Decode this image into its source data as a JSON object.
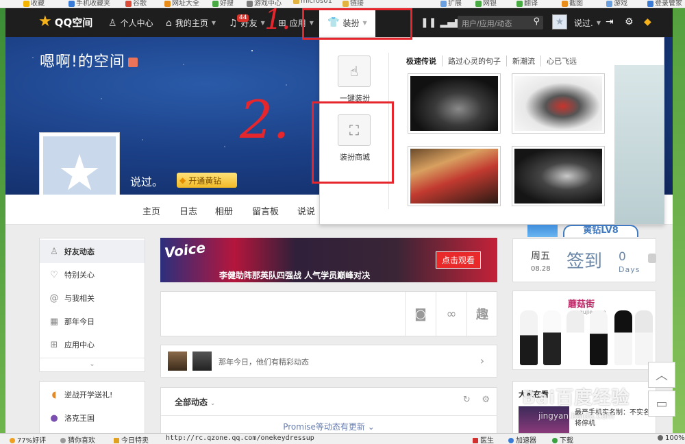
{
  "favorites": [
    "收藏",
    "手机收藏夹",
    "谷歌",
    "网址大全",
    "好搜",
    "游戏中心",
    "micros01",
    "链接",
    "扩展",
    "网银",
    "翻译",
    "截图",
    "游戏",
    "登录管家"
  ],
  "topnav": {
    "logo": "QQ空间",
    "items": {
      "personal": "个人中心",
      "home": "我的主页",
      "friends": "好友",
      "friends_badge": "44",
      "apps": "应用",
      "dressup": "装扮"
    },
    "search_placeholder": "用户/应用/动态",
    "username": "说过."
  },
  "annotations": {
    "one": "1.",
    "two": "2."
  },
  "profile": {
    "title": "嗯啊!的空间",
    "nickname": "说过。",
    "vip_button": "开通黄钻",
    "tabs": [
      "主页",
      "日志",
      "相册",
      "留言板",
      "说说"
    ]
  },
  "dress_menu": {
    "one_click": "一键装扮",
    "mall": "装扮商城",
    "themes": [
      "极速传说",
      "路过心灵的句子",
      "新潮流",
      "心已飞远"
    ]
  },
  "sidebar": {
    "main": [
      {
        "icon": "person",
        "label": "好友动态"
      },
      {
        "icon": "heart",
        "label": "特别关心"
      },
      {
        "icon": "at",
        "label": "与我相关"
      },
      {
        "icon": "calendar",
        "label": "那年今日"
      },
      {
        "icon": "grid",
        "label": "应用中心"
      }
    ],
    "extra": [
      {
        "label": "逆战开学送礼!"
      },
      {
        "label": "洛克王国"
      }
    ]
  },
  "ad": {
    "brand": "Voice",
    "caption": "李健助阵那英队四强战 人气学员巅峰对决",
    "watch": "点击观看"
  },
  "memory": {
    "text": "那年今日，他们有精彩动态"
  },
  "feed": {
    "title": "全部动态",
    "update": "Promise等动态有更新"
  },
  "signin": {
    "weekday": "周五",
    "date": "08.28",
    "label": "签到",
    "days_count": "0",
    "days_label": "Days"
  },
  "level_badge": "黄钻LV8",
  "shop_ad": {
    "name": "蘑菇街",
    "domain": "mogujie.com"
  },
  "news": {
    "title": "大家在看",
    "text": "最严手机实名制：不实名将停机"
  },
  "watermark": {
    "main": "Bai百度经验",
    "sub": "jingyan.baidu.com"
  },
  "statusbar": {
    "left": [
      "77%好评",
      "猜你喜欢",
      "今日特卖"
    ],
    "url": "http://rc.qzone.qq.com/onekeydressup",
    "right": [
      "医生",
      "加速器",
      "下载",
      "100%"
    ]
  },
  "colors": {
    "nav": "#1e1e1e",
    "annotation": "#e5262d",
    "banner": "#1b3f86",
    "vip": "#f2b926"
  }
}
